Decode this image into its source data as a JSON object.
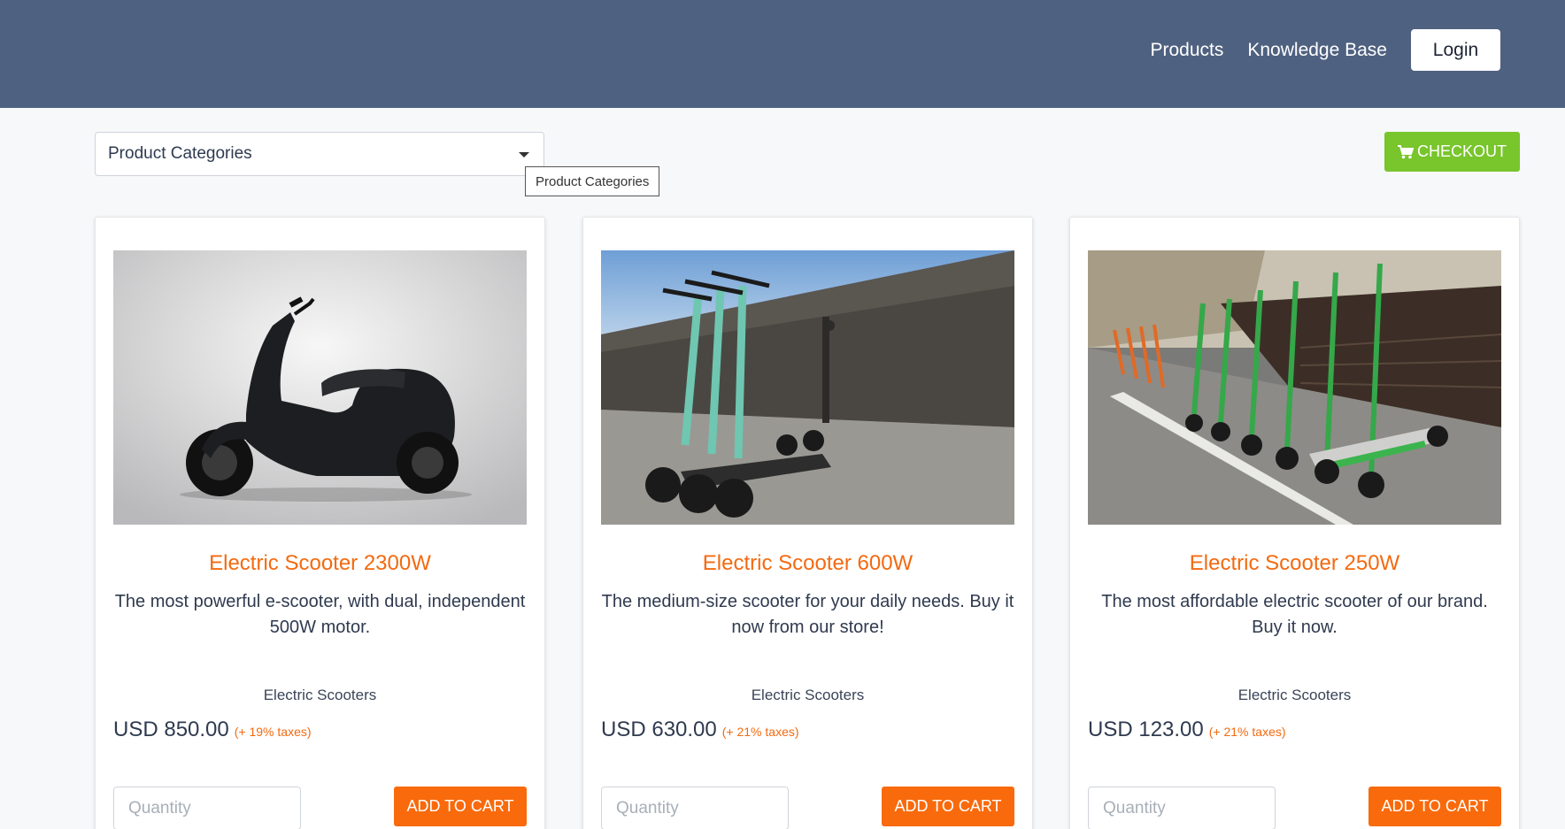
{
  "nav": {
    "products": "Products",
    "knowledge_base": "Knowledge Base",
    "login": "Login"
  },
  "filter": {
    "category_select": "Product Categories",
    "tooltip": "Product Categories"
  },
  "checkout": {
    "label": "CHECKOUT",
    "icon": "shopping-cart-icon"
  },
  "colors": {
    "header_bg": "#4f6180",
    "accent_orange": "#f96a0c",
    "checkout_green": "#78c52c"
  },
  "products": [
    {
      "title": "Electric Scooter 2300W",
      "description": "The most powerful e-scooter, with dual, independent 500W motor.",
      "category": "Electric Scooters",
      "price": "USD 850.00",
      "tax": "(+ 19% taxes)",
      "quantity_placeholder": "Quantity",
      "add_to_cart": "ADD TO CART"
    },
    {
      "title": "Electric Scooter 600W",
      "description": "The medium-size scooter for your daily needs. Buy it now from our store!",
      "category": "Electric Scooters",
      "price": "USD 630.00",
      "tax": "(+ 21% taxes)",
      "quantity_placeholder": "Quantity",
      "add_to_cart": "ADD TO CART"
    },
    {
      "title": "Electric Scooter 250W",
      "description": "The most affordable electric scooter of our brand. Buy it now.",
      "category": "Electric Scooters",
      "price": "USD 123.00",
      "tax": "(+ 21% taxes)",
      "quantity_placeholder": "Quantity",
      "add_to_cart": "ADD TO CART"
    }
  ]
}
